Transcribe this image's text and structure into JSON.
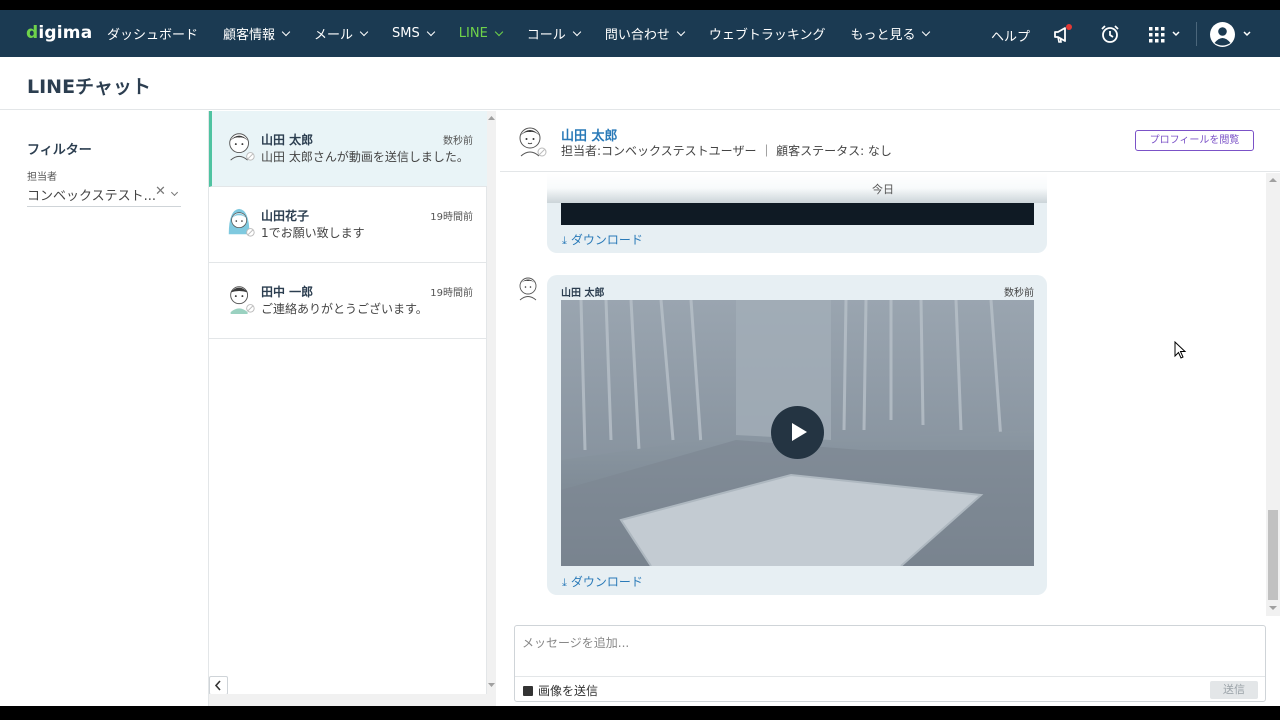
{
  "nav": {
    "logo": "digima",
    "items": [
      {
        "label": "ダッシュボード",
        "dropdown": false
      },
      {
        "label": "顧客情報",
        "dropdown": true
      },
      {
        "label": "メール",
        "dropdown": true
      },
      {
        "label": "SMS",
        "dropdown": true
      },
      {
        "label": "LINE",
        "dropdown": true,
        "active": true
      },
      {
        "label": "コール",
        "dropdown": true
      },
      {
        "label": "問い合わせ",
        "dropdown": true
      },
      {
        "label": "ウェブトラッキング",
        "dropdown": false
      },
      {
        "label": "もっと見る",
        "dropdown": true
      }
    ],
    "help": "ヘルプ",
    "icons": [
      "megaphone-icon",
      "alarm-clock-icon",
      "apps-grid-icon",
      "user-avatar-icon"
    ],
    "active_color": "#6fd34a",
    "bg_color": "#1b3a52"
  },
  "page": {
    "title": "LINEチャット"
  },
  "filter": {
    "title": "フィルター",
    "assignee_label": "担当者",
    "assignee_value": "コンベックステスト...",
    "clear_symbol": "✕"
  },
  "conversations": [
    {
      "name": "山田 太郎",
      "time": "数秒前",
      "message": "山田 太郎さんが動画を送信しました。",
      "active": true
    },
    {
      "name": "山田花子",
      "time": "19時間前",
      "message": "1でお願い致します",
      "active": false
    },
    {
      "name": "田中 一郎",
      "time": "19時間前",
      "message": "ご連絡ありがとうございます。",
      "active": false
    }
  ],
  "chat": {
    "contact_name": "山田 太郎",
    "contact_sub": "担当者:コンベックステストユーザー ｜ 顧客ステータス: なし",
    "profile_button": "プロフィールを閲覧",
    "date_separator": "今日",
    "download_label": "ダウンロード",
    "message": {
      "sender": "山田 太郎",
      "time": "数秒前"
    },
    "composer_placeholder": "メッセージを追加...",
    "image_send_label": "画像を送信",
    "send_label": "送信"
  }
}
